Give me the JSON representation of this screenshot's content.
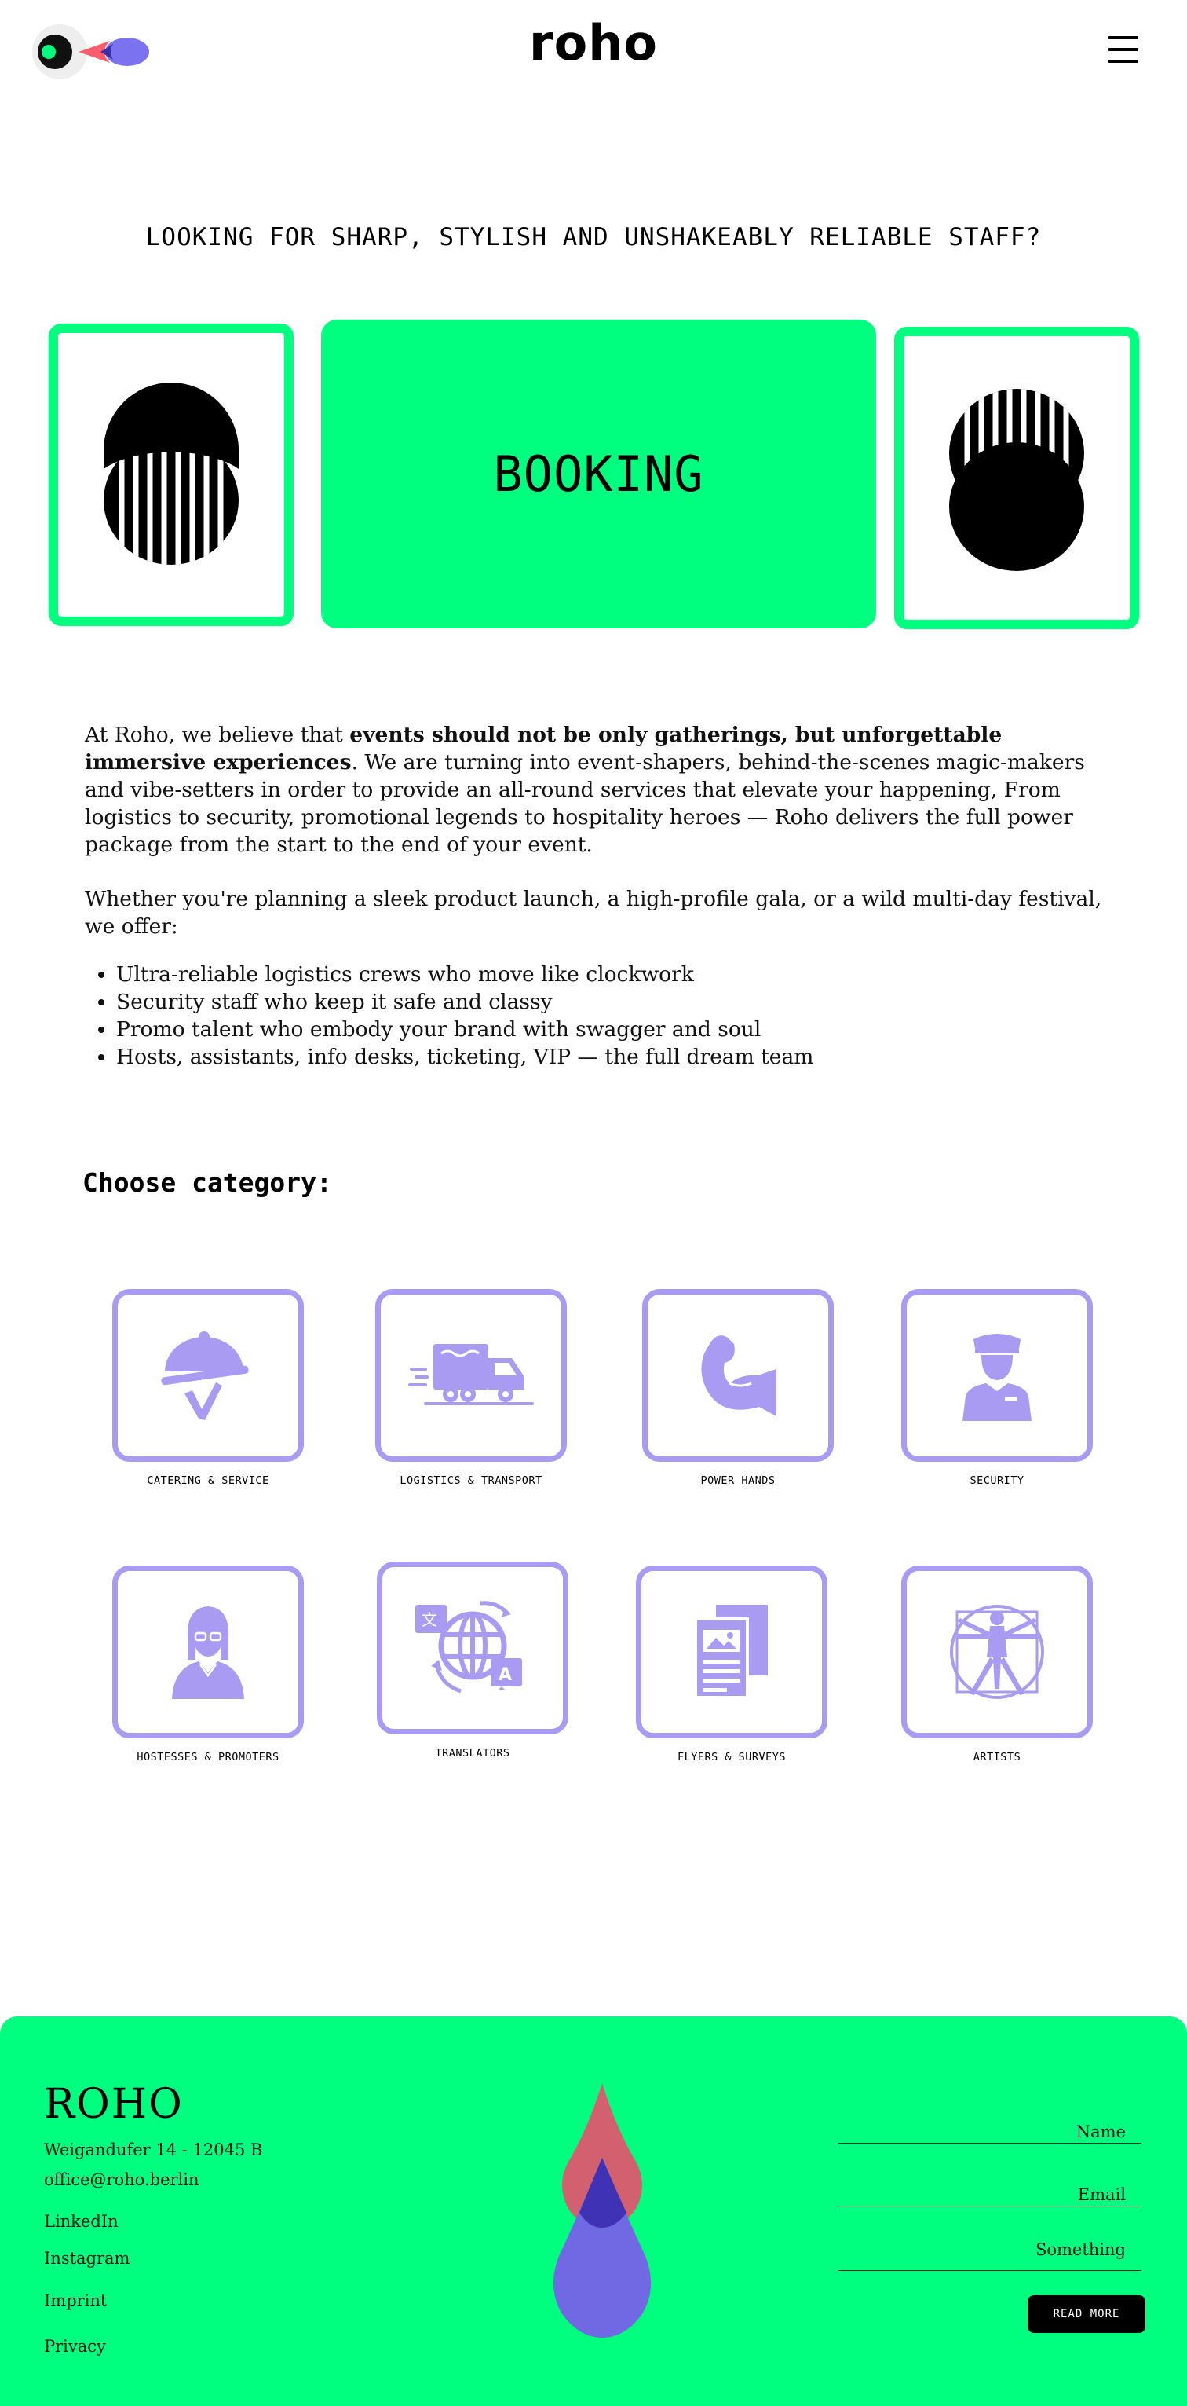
{
  "header": {
    "brand": "roho",
    "logo_icon": "eye-drop-logo",
    "menu_icon": "hamburger-menu-icon"
  },
  "hero": {
    "headline": "LOOKING FOR SHARP, STYLISH AND UNSHAKEABLY RELIABLE STAFF?",
    "booking_label": "BOOKING",
    "accent_color": "#00ff7f"
  },
  "intro": {
    "p1_start": "At Roho, we believe that ",
    "p1_bold": "events should not be only gatherings, but unforgettable immersive experiences",
    "p1_end": ".  We are turning into event-shapers, behind-the-scenes magic-makers and vibe-setters in order to provide an all-round services that elevate your happening, From logistics to security, promotional legends to hospitality heroes — Roho delivers the full power package from the start to the end of your event.",
    "p2": "Whether you're planning a sleek product launch, a high-profile gala, or a wild multi-day festival, we offer:",
    "offers": [
      "Ultra-reliable logistics crews who move like clockwork",
      " Security staff who keep it safe and classy",
      "Promo talent who embody your brand with swagger and soul",
      " Hosts, assistants, info desks, ticketing, VIP — the full dream team"
    ]
  },
  "categories": {
    "title": "Choose category:",
    "icon_color": "#a99bf1",
    "items": [
      {
        "label": "Catering & Service",
        "icon": "catering-cloche-icon"
      },
      {
        "label": "Logistics & Transport",
        "icon": "delivery-truck-icon"
      },
      {
        "label": "Power Hands",
        "icon": "flexed-arm-icon"
      },
      {
        "label": "Security",
        "icon": "security-guard-icon"
      },
      {
        "label": "Hostesses & Promoters",
        "icon": "hostess-icon"
      },
      {
        "label": "Translators",
        "icon": "translation-globe-icon"
      },
      {
        "label": "Flyers & Surveys",
        "icon": "flyers-documents-icon"
      },
      {
        "label": "Artists",
        "icon": "vitruvian-man-icon"
      }
    ]
  },
  "footer": {
    "brand": "ROHO",
    "address": "Weigandufer 14 - 12045 B",
    "email": "office@roho.berlin",
    "links": [
      "LinkedIn",
      "Instagram",
      "Imprint",
      "Privacy"
    ],
    "form": {
      "name_placeholder": "Name",
      "email_placeholder": "Email",
      "message_placeholder": "Something",
      "submit_label": "READ MORE"
    }
  }
}
